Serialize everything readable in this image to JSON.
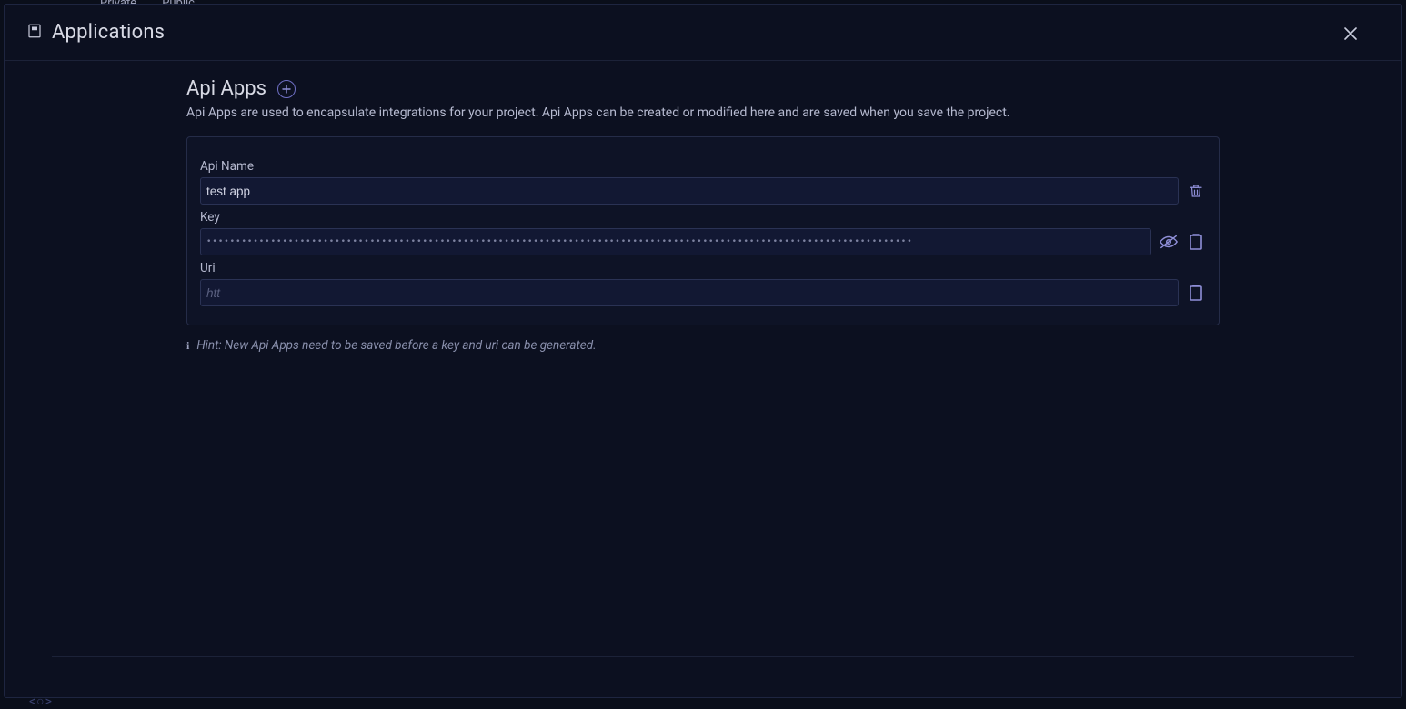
{
  "background": {
    "tabs": [
      "Private",
      "Public"
    ]
  },
  "modal": {
    "title": "Applications",
    "section": {
      "title": "Api Apps",
      "description": "Api Apps are used to encapsulate integrations for your project. Api Apps can be created or modified here and are saved when you save the project."
    },
    "app": {
      "name_label": "Api Name",
      "name_value": "test app",
      "key_label": "Key",
      "key_masked": "•••••••••••••••••••••••••••••••••••••••••••••••••••••••••••••••••••••••••••••••••••••••••••••••••••••••••••••••••••••••••",
      "uri_label": "Uri",
      "uri_placeholder": "htt"
    },
    "hint": "Hint: New Api Apps need to be saved before a key and uri can be generated."
  }
}
